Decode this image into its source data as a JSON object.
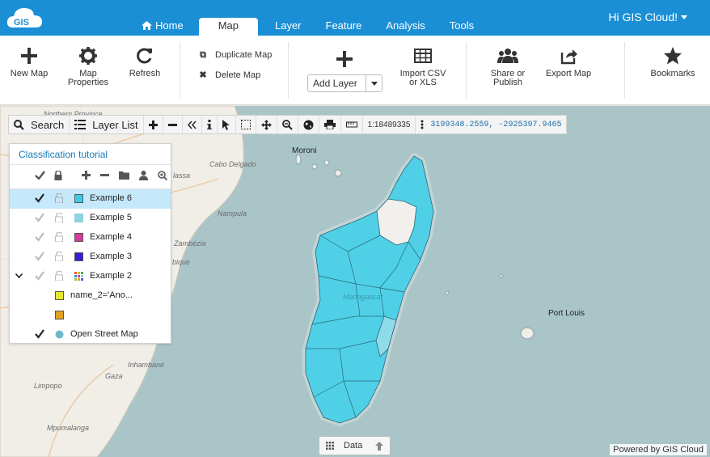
{
  "header": {
    "logo_text": "GIS",
    "tabs": [
      {
        "label": "Home",
        "icon": "home-icon"
      },
      {
        "label": "Map",
        "active": true
      },
      {
        "label": "Layer"
      },
      {
        "label": "Feature"
      },
      {
        "label": "Analysis"
      },
      {
        "label": "Tools"
      }
    ],
    "greeting": "Hi GIS Cloud!"
  },
  "ribbon": {
    "new_map": "New Map",
    "map_properties": "Map Properties",
    "refresh": "Refresh",
    "duplicate_map": "Duplicate Map",
    "delete_map": "Delete Map",
    "add_layer": "Add Layer",
    "import_csv": "Import CSV or XLS",
    "share": "Share or Publish",
    "export": "Export Map",
    "bookmarks": "Bookmarks"
  },
  "map_toolbar": {
    "search": "Search",
    "layer_list": "Layer List",
    "scale": "1:18489335",
    "coordinates": "3199348.2559, -2925397.9465"
  },
  "layer_panel": {
    "title": "Classification tutorial",
    "layers": [
      {
        "name": "Example 6",
        "color": "#3ccbe6",
        "checked": true,
        "selected": true
      },
      {
        "name": "Example 5",
        "color": "#8fd3e0",
        "checked": true
      },
      {
        "name": "Example 4",
        "color": "#d63aa0",
        "checked": true
      },
      {
        "name": "Example 3",
        "color": "#3020d8",
        "checked": true
      },
      {
        "name": "Example 2",
        "color": "multi",
        "checked": true,
        "expanded": true
      },
      {
        "name": "name_2='Ano...",
        "color": "#e6e630",
        "sub": true
      },
      {
        "name": "",
        "color": "#e0a020",
        "sub": true
      },
      {
        "name": "Open Street Map",
        "color": "globe",
        "checked": true
      }
    ]
  },
  "map_labels": {
    "moroni": "Moroni",
    "port_louis": "Port Louis",
    "cabo_delgado": "Cabo Delgado",
    "nampula": "Nampula",
    "zambezia": "Zambézia",
    "inhambane": "Inhambane",
    "gaza": "Gaza",
    "limpopo": "Limpopo",
    "mpumalanga": "Mpumalanga",
    "northern_province": "Northern Province",
    "lassa": "lassa",
    "bique": "bique",
    "madagascar": "Madagascar"
  },
  "data_tab": {
    "label": "Data"
  },
  "footer": {
    "powered": "Powered by GIS Cloud"
  },
  "colors": {
    "header": "#1a8fd6",
    "accent": "#1a7ab9",
    "fill_main": "#4fd0e6",
    "fill_light": "#8fdbea",
    "fill_white": "#f2f0ec"
  }
}
